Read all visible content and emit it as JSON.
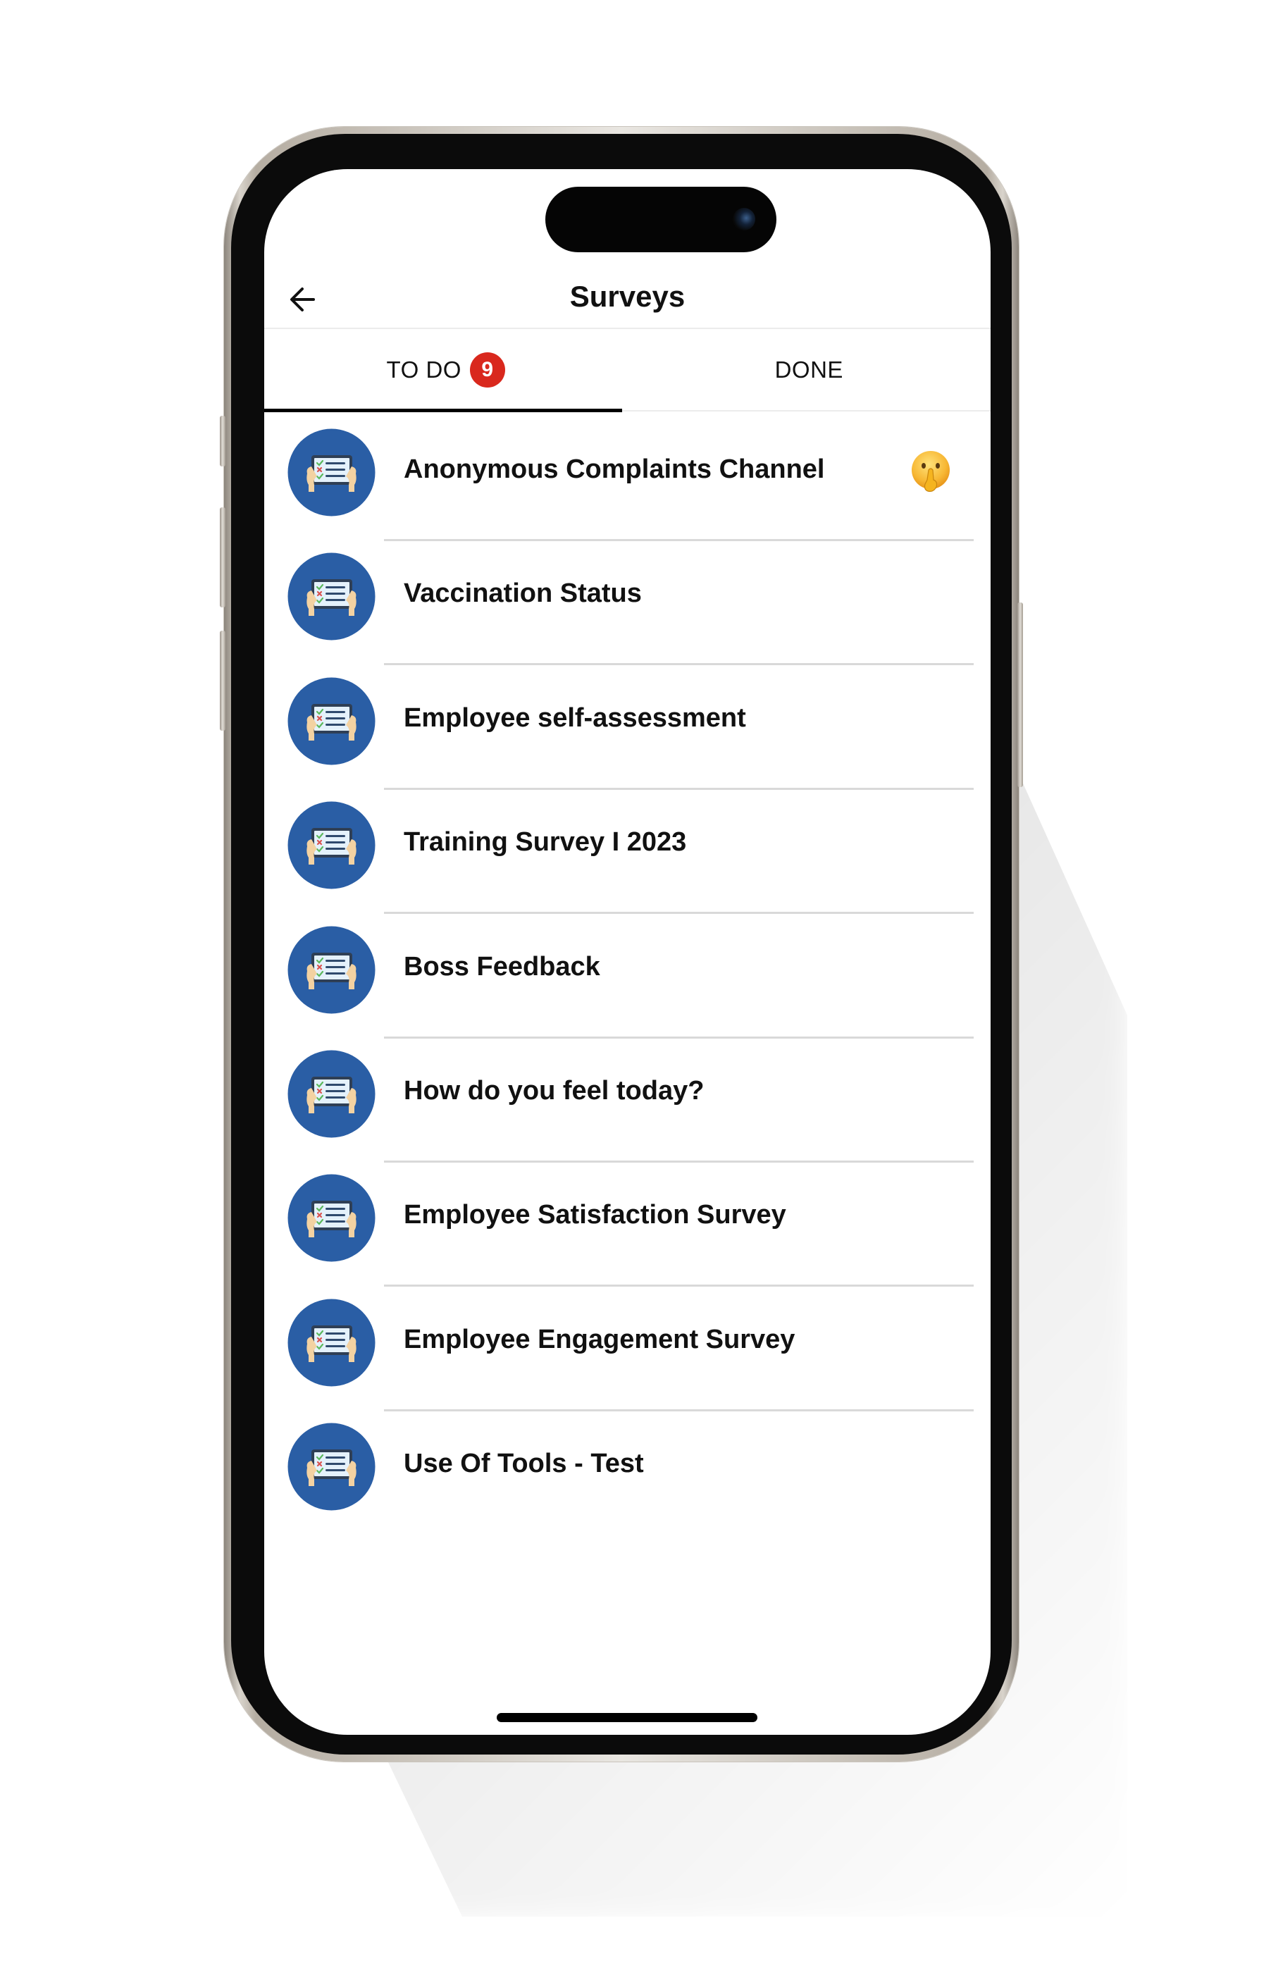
{
  "header": {
    "title": "Surveys",
    "back_icon": "arrow-left-icon"
  },
  "tabs": [
    {
      "label": "TO DO",
      "badge": "9",
      "active": true
    },
    {
      "label": "DONE",
      "active": false
    }
  ],
  "colors": {
    "badge": "#d9281d",
    "icon_circle": "#2a5ea5",
    "active_underline": "#000000"
  },
  "surveys": [
    {
      "title": "Anonymous Complaints Channel",
      "icon": "survey-tablet-icon",
      "trailing_icon": "shushing-face-emoji"
    },
    {
      "title": "Vaccination Status",
      "icon": "survey-tablet-icon"
    },
    {
      "title": "Employee self-assessment",
      "icon": "survey-tablet-icon"
    },
    {
      "title": "Training Survey I 2023",
      "icon": "survey-tablet-icon"
    },
    {
      "title": "Boss Feedback",
      "icon": "survey-tablet-icon"
    },
    {
      "title": "How do you feel today?",
      "icon": "survey-tablet-icon"
    },
    {
      "title": "Employee Satisfaction Survey",
      "icon": "survey-tablet-icon"
    },
    {
      "title": "Employee Engagement Survey",
      "icon": "survey-tablet-icon"
    },
    {
      "title": "Use Of Tools - Test",
      "icon": "survey-tablet-icon"
    }
  ]
}
